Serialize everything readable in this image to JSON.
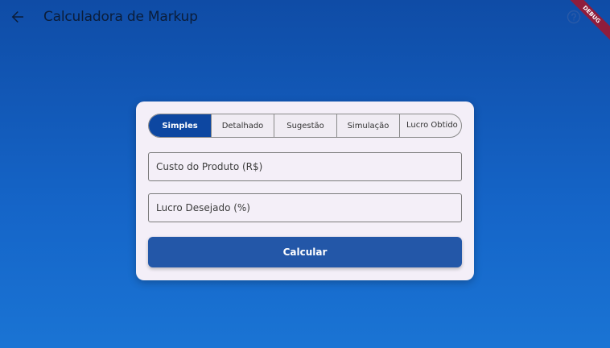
{
  "appbar": {
    "title": "Calculadora de Markup",
    "back_icon": "arrow-left-icon",
    "help_icon": "help-circle-icon"
  },
  "debug_banner": "DEBUG",
  "tabs": [
    {
      "label": "Simples",
      "selected": true
    },
    {
      "label": "Detalhado",
      "selected": false
    },
    {
      "label": "Sugestão",
      "selected": false
    },
    {
      "label": "Simulação",
      "selected": false
    },
    {
      "label": "Lucro Obtido",
      "selected": false
    }
  ],
  "form": {
    "cost_label": "Custo do Produto (R$)",
    "profit_label": "Lucro Desejado (%)",
    "calculate_label": "Calcular"
  },
  "colors": {
    "background_top": "#0f4ca6",
    "background_bottom": "#1a74d4",
    "selected_tab": "#0d47a1",
    "button": "#2357a8",
    "card": "#f4eff8",
    "debug_ribbon": "#8f1d3c"
  }
}
